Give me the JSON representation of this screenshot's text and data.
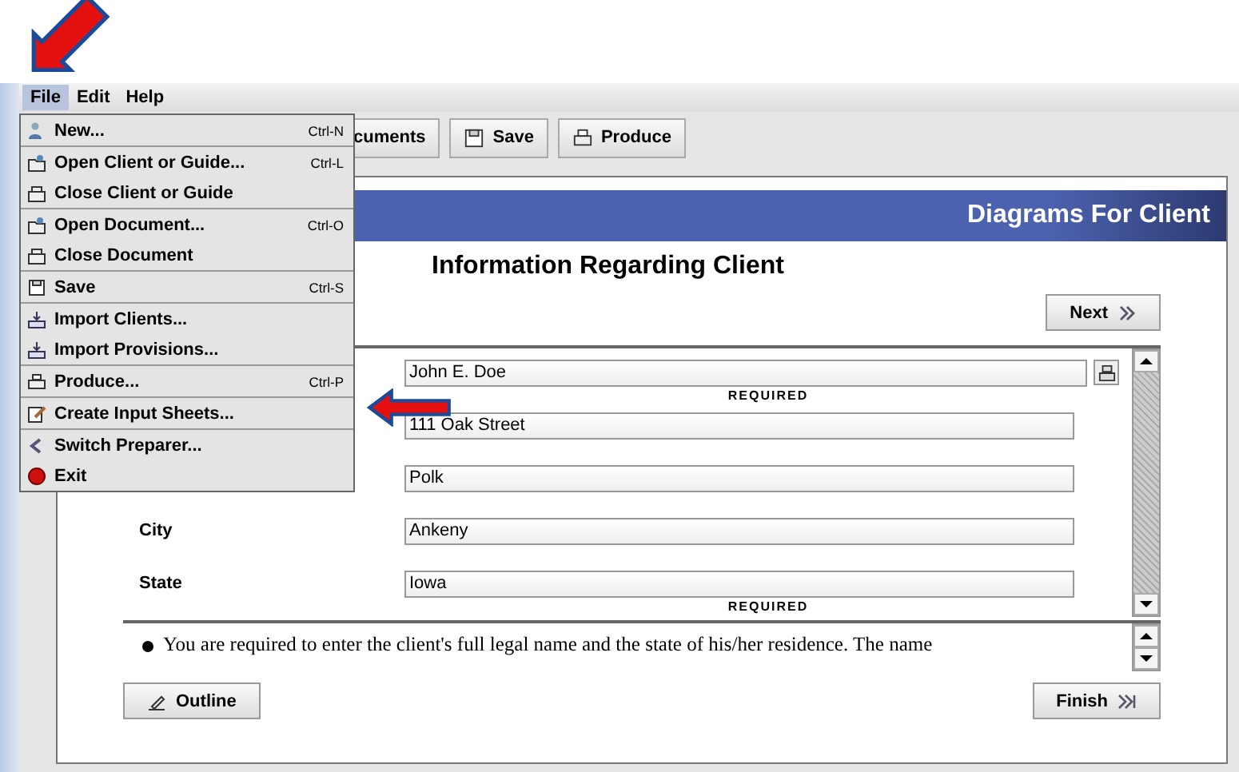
{
  "menubar": [
    {
      "label": "File",
      "selected": true
    },
    {
      "label": "Edit",
      "selected": false
    },
    {
      "label": "Help",
      "selected": false
    }
  ],
  "file_menu": [
    [
      {
        "label": "New...",
        "shortcut": "Ctrl-N"
      }
    ],
    [
      {
        "label": "Open Client or Guide...",
        "shortcut": "Ctrl-L"
      },
      {
        "label": "Close Client or Guide"
      }
    ],
    [
      {
        "label": "Open Document...",
        "shortcut": "Ctrl-O"
      },
      {
        "label": "Close Document"
      }
    ],
    [
      {
        "label": "Save",
        "shortcut": "Ctrl-S"
      }
    ],
    [
      {
        "label": "Import Clients..."
      },
      {
        "label": "Import Provisions..."
      }
    ],
    [
      {
        "label": "Produce...",
        "shortcut": "Ctrl-P"
      }
    ],
    [
      {
        "label": "Create Input Sheets..."
      }
    ],
    [
      {
        "label": "Switch Preparer..."
      },
      {
        "label": "Exit"
      }
    ]
  ],
  "toolbar": [
    {
      "label": "cuments"
    },
    {
      "label": "Save"
    },
    {
      "label": "Produce"
    }
  ],
  "header": {
    "title": "Diagrams For Client"
  },
  "page_title": "Information Regarding Client",
  "next_button": "Next",
  "form_rows": [
    {
      "value": "John E. Doe",
      "required": true,
      "note": "REQUIRED",
      "lookup": true
    },
    {
      "value": "111 Oak Street",
      "required": false,
      "lookup": false
    },
    {
      "value": "Polk",
      "required": false,
      "lookup": false
    },
    {
      "label": "City",
      "value": "Ankeny",
      "required": false,
      "lookup": false
    },
    {
      "label": "State",
      "value": "Iowa",
      "required": true,
      "note": "REQUIRED",
      "lookup": false
    }
  ],
  "description": "You are required to enter the client's full legal name and the state of his/her residence. The name",
  "outline_button": "Outline",
  "finish_button": "Finish"
}
